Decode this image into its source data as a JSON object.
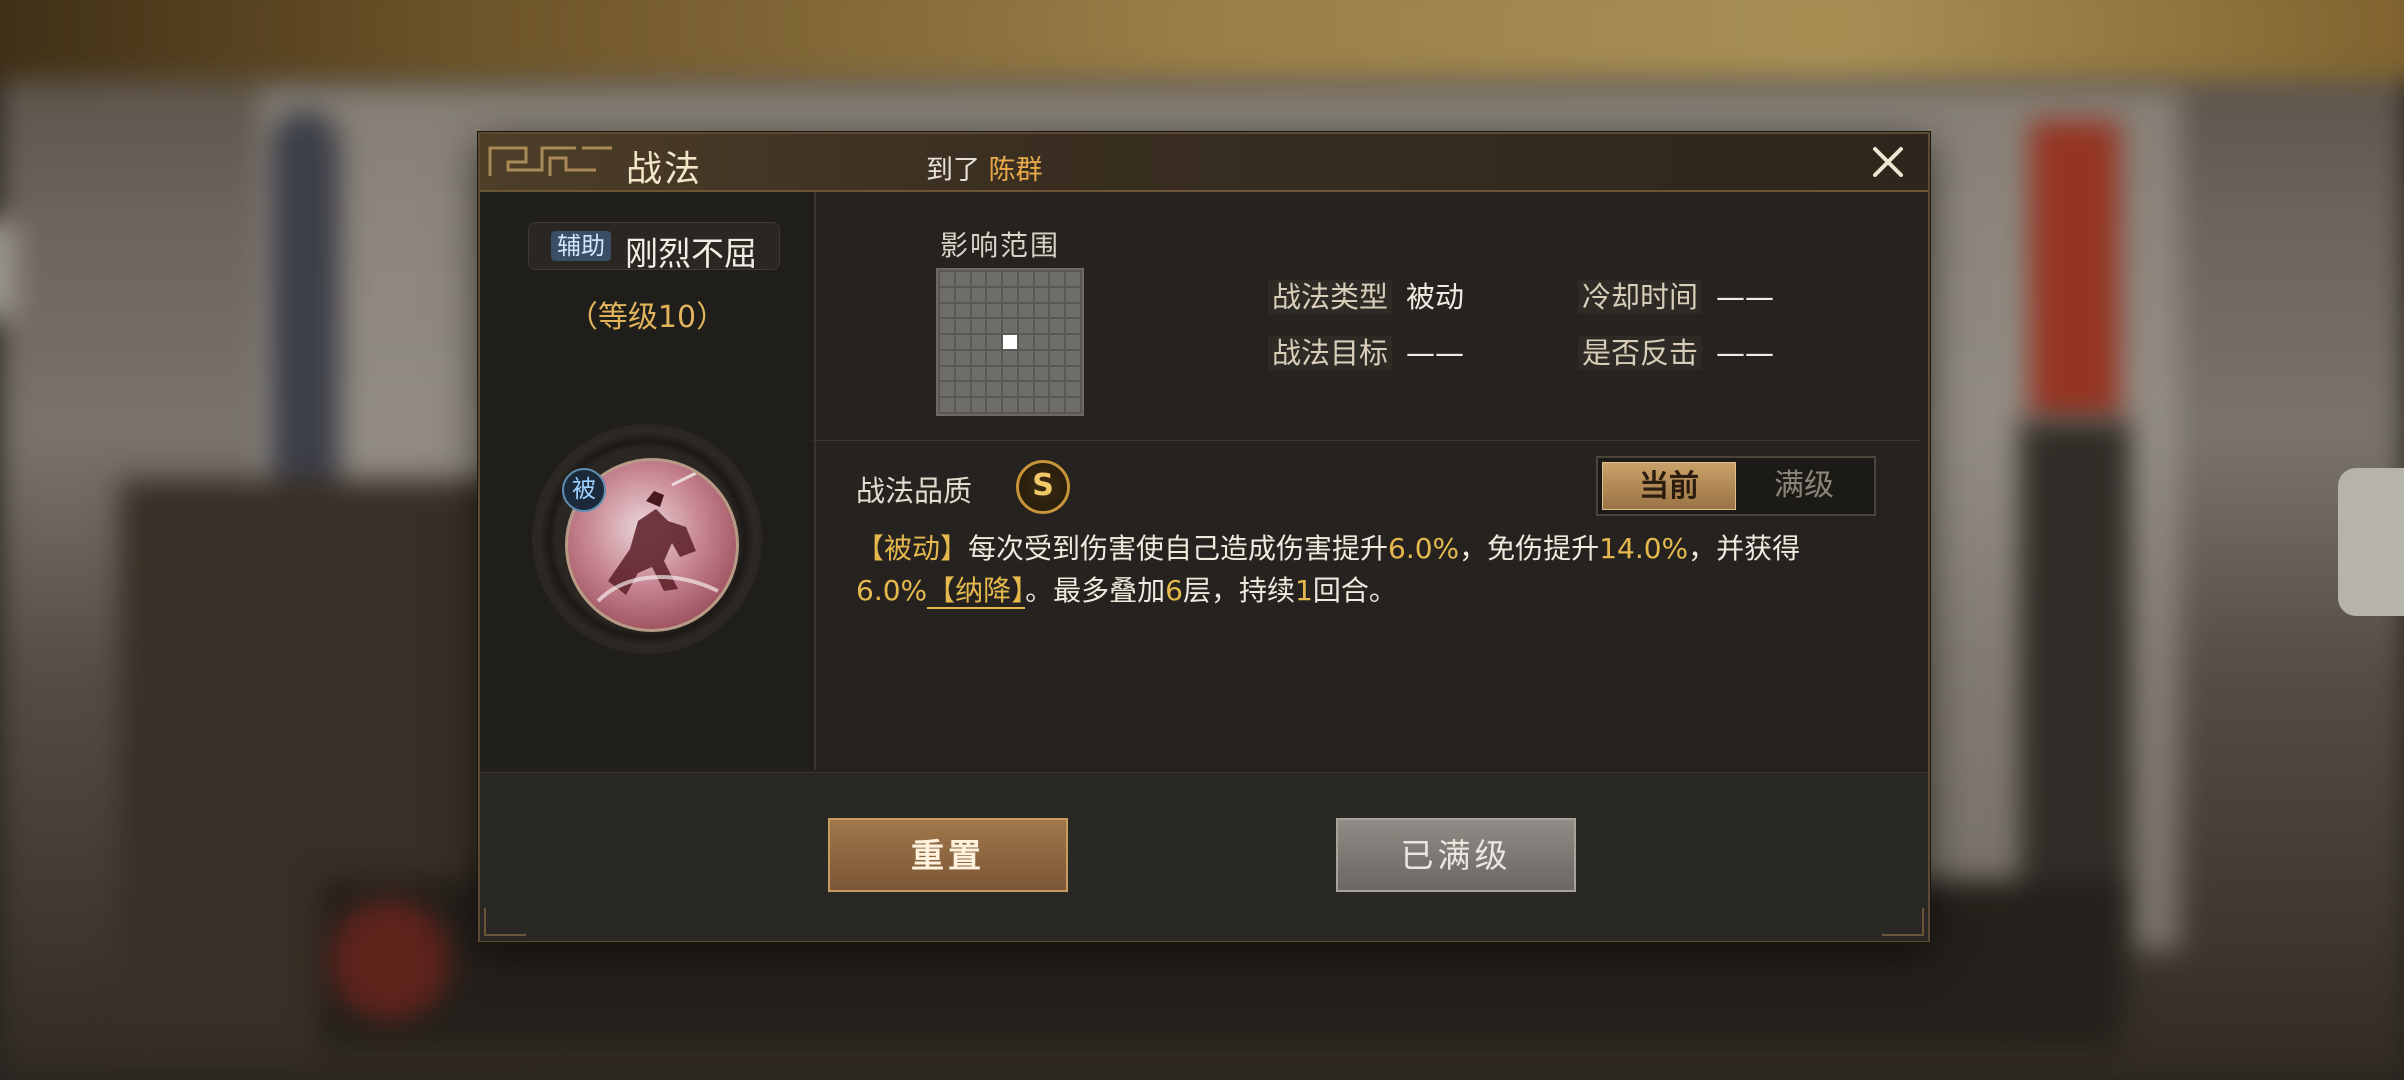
{
  "dialog": {
    "title": "战法",
    "subtitle_prefix": "到了",
    "subtitle_name": "陈群"
  },
  "skill": {
    "type_tag": "辅助",
    "name": "刚烈不屈",
    "level": "（等级10）",
    "passive_badge": "被"
  },
  "range": {
    "label": "影响范围",
    "grid_size": 9,
    "active_cell": "center"
  },
  "info": {
    "type_label": "战法类型",
    "type_value": "被动",
    "cooldown_label": "冷却时间",
    "cooldown_value": "——",
    "target_label": "战法目标",
    "target_value": "——",
    "counter_label": "是否反击",
    "counter_value": "——"
  },
  "quality": {
    "label": "战法品质",
    "grade": "S"
  },
  "toggle": {
    "current": "当前",
    "max": "满级",
    "selected": "current"
  },
  "description": {
    "tag": "【被动】",
    "t1": "每次受到伤害使自己造成伤害提升",
    "v1": "6.0%",
    "t2": "，免伤提升",
    "v2": "14.0%",
    "t3": "，并获得",
    "v3": "6.0%",
    "link": "【纳降】",
    "t4": "。最多叠加",
    "v4": "6",
    "t5": "层，持续",
    "v5": "1",
    "t6": "回合。"
  },
  "buttons": {
    "reset": "重置",
    "maxed": "已满级"
  },
  "colors": {
    "accent_gold": "#e6b94e",
    "name_orange": "#e9a94a",
    "active_tab": "#c9a068"
  }
}
